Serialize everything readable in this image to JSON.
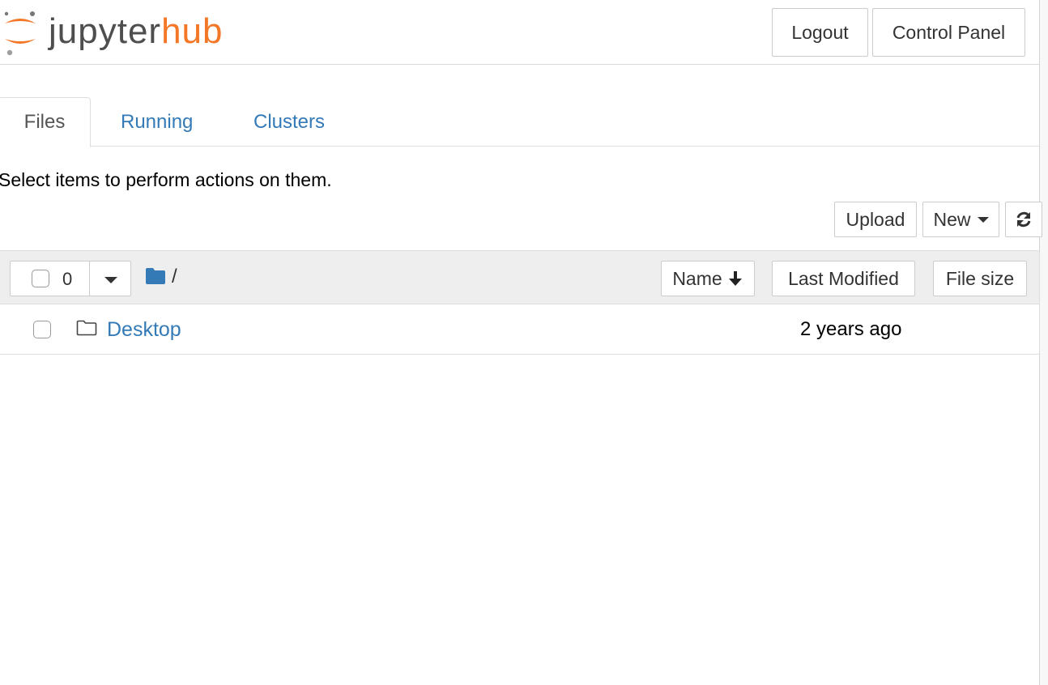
{
  "header": {
    "logo_primary": "jupyter",
    "logo_accent": "hub",
    "logout_label": "Logout",
    "control_panel_label": "Control Panel"
  },
  "tabs": [
    {
      "label": "Files",
      "active": true
    },
    {
      "label": "Running",
      "active": false
    },
    {
      "label": "Clusters",
      "active": false
    }
  ],
  "hint_text": "Select items to perform actions on them.",
  "toolbar": {
    "upload_label": "Upload",
    "new_label": "New",
    "refresh_icon": "refresh-icon"
  },
  "list_header": {
    "selected_count": "0",
    "breadcrumb_path": "/",
    "sort_name_label": "Name",
    "sort_name_icon": "arrow-down-icon",
    "sort_modified_label": "Last Modified",
    "sort_size_label": "File size"
  },
  "items": [
    {
      "name": "Desktop",
      "type": "folder",
      "modified": "2 years ago"
    }
  ],
  "colors": {
    "accent": "#f37726",
    "link": "#337ab7",
    "header_bg": "#eeeeee"
  }
}
